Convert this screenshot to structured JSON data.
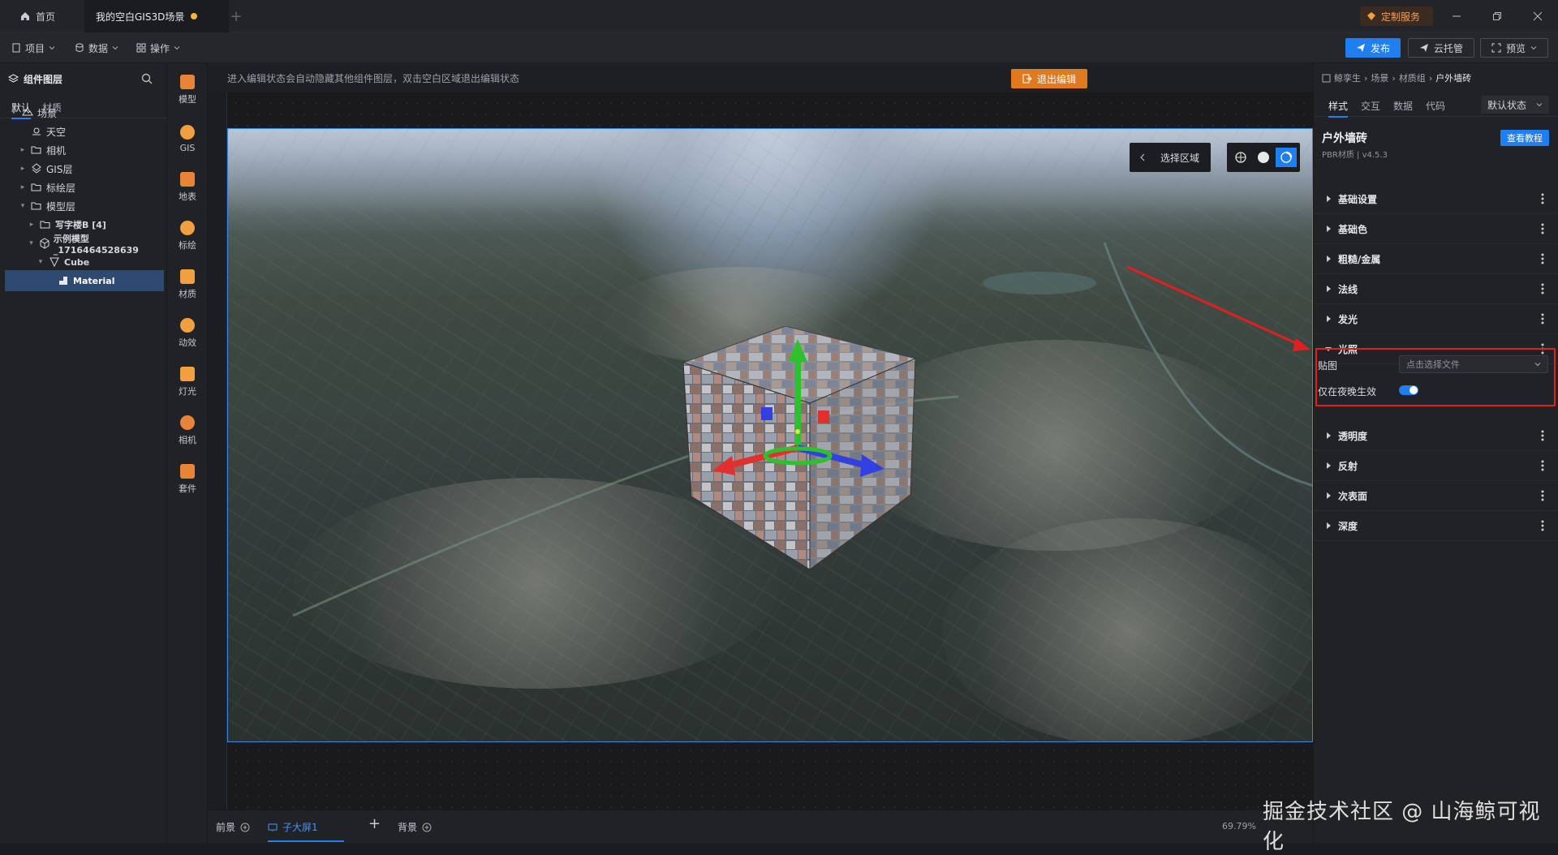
{
  "titlebar": {
    "home_tab": "首页",
    "scene_tab": "我的空白GIS3D场景",
    "custom_service": "定制服务"
  },
  "menubar": {
    "project": "项目",
    "data": "数据",
    "operate": "操作",
    "publish": "发布",
    "cloud": "云托管",
    "preview": "预览"
  },
  "left_panel": {
    "title": "组件图层",
    "tabs": [
      "默认",
      "材质"
    ],
    "tree": [
      {
        "label": "场景",
        "level": 0,
        "expanded": true,
        "icon": "scene-icon"
      },
      {
        "label": "天空",
        "level": 1,
        "icon": "sky-icon"
      },
      {
        "label": "相机",
        "level": 1,
        "icon": "folder-icon"
      },
      {
        "label": "GIS层",
        "level": 1,
        "icon": "gis-layer-icon"
      },
      {
        "label": "标绘层",
        "level": 1,
        "icon": "folder-icon"
      },
      {
        "label": "模型层",
        "level": 1,
        "expanded": true,
        "icon": "folder-icon"
      },
      {
        "label": "写字楼B [4]",
        "level": 2,
        "icon": "folder-icon"
      },
      {
        "label": "示例模型_1716464528639",
        "level": 2,
        "expanded": true,
        "icon": "model-icon"
      },
      {
        "label": "Cube",
        "level": 3,
        "expanded": true,
        "icon": "mesh-icon"
      },
      {
        "label": "Material",
        "level": 4,
        "selected": true,
        "icon": "material-icon"
      }
    ]
  },
  "tools": [
    {
      "label": "模型",
      "icon": "model-tool-icon",
      "color": "#e8843a"
    },
    {
      "label": "GIS",
      "icon": "gis-tool-icon",
      "color": "#f0a040"
    },
    {
      "label": "地表",
      "icon": "terrain-tool-icon",
      "color": "#e8843a"
    },
    {
      "label": "标绘",
      "icon": "marker-tool-icon",
      "color": "#f0a040"
    },
    {
      "label": "材质",
      "icon": "material-tool-icon",
      "color": "#f0a040"
    },
    {
      "label": "动效",
      "icon": "effect-tool-icon",
      "color": "#f0a040"
    },
    {
      "label": "灯光",
      "icon": "light-tool-icon",
      "color": "#f0a040"
    },
    {
      "label": "相机",
      "icon": "camera-tool-icon",
      "color": "#e8843a"
    },
    {
      "label": "套件",
      "icon": "kit-tool-icon",
      "color": "#e8843a"
    }
  ],
  "canvas": {
    "hint": "进入编辑状态会自动隐藏其他组件图层，双击空白区域退出编辑状态",
    "exit_edit": "退出编辑",
    "select_region": "选择区域"
  },
  "bottombar": {
    "foreground": "前景",
    "sub_screen": "子大屏1",
    "background": "背景",
    "zoom": "69.79%"
  },
  "right_panel": {
    "breadcrumb": [
      "鲸孪生",
      "场景",
      "材质组",
      "户外墙砖"
    ],
    "tabs": [
      "样式",
      "交互",
      "数据",
      "代码"
    ],
    "state_select": "默认状态",
    "material_title": "户外墙砖",
    "material_sub": "PBR材质 | v4.5.3",
    "tutorial": "查看教程",
    "sections": [
      "基础设置",
      "基础色",
      "粗糙/金属",
      "法线",
      "发光",
      "光照",
      "透明度",
      "反射",
      "次表面",
      "深度"
    ],
    "lighting": {
      "map_label": "贴图",
      "map_placeholder": "点击选择文件",
      "night_label": "仅在夜晚生效",
      "night_enabled": true
    }
  },
  "watermark": "掘金技术社区 @ 山海鲸可视化",
  "colors": {
    "accent": "#1f7ef0",
    "highlight": "#e02020",
    "exit": "#e07a1e"
  }
}
